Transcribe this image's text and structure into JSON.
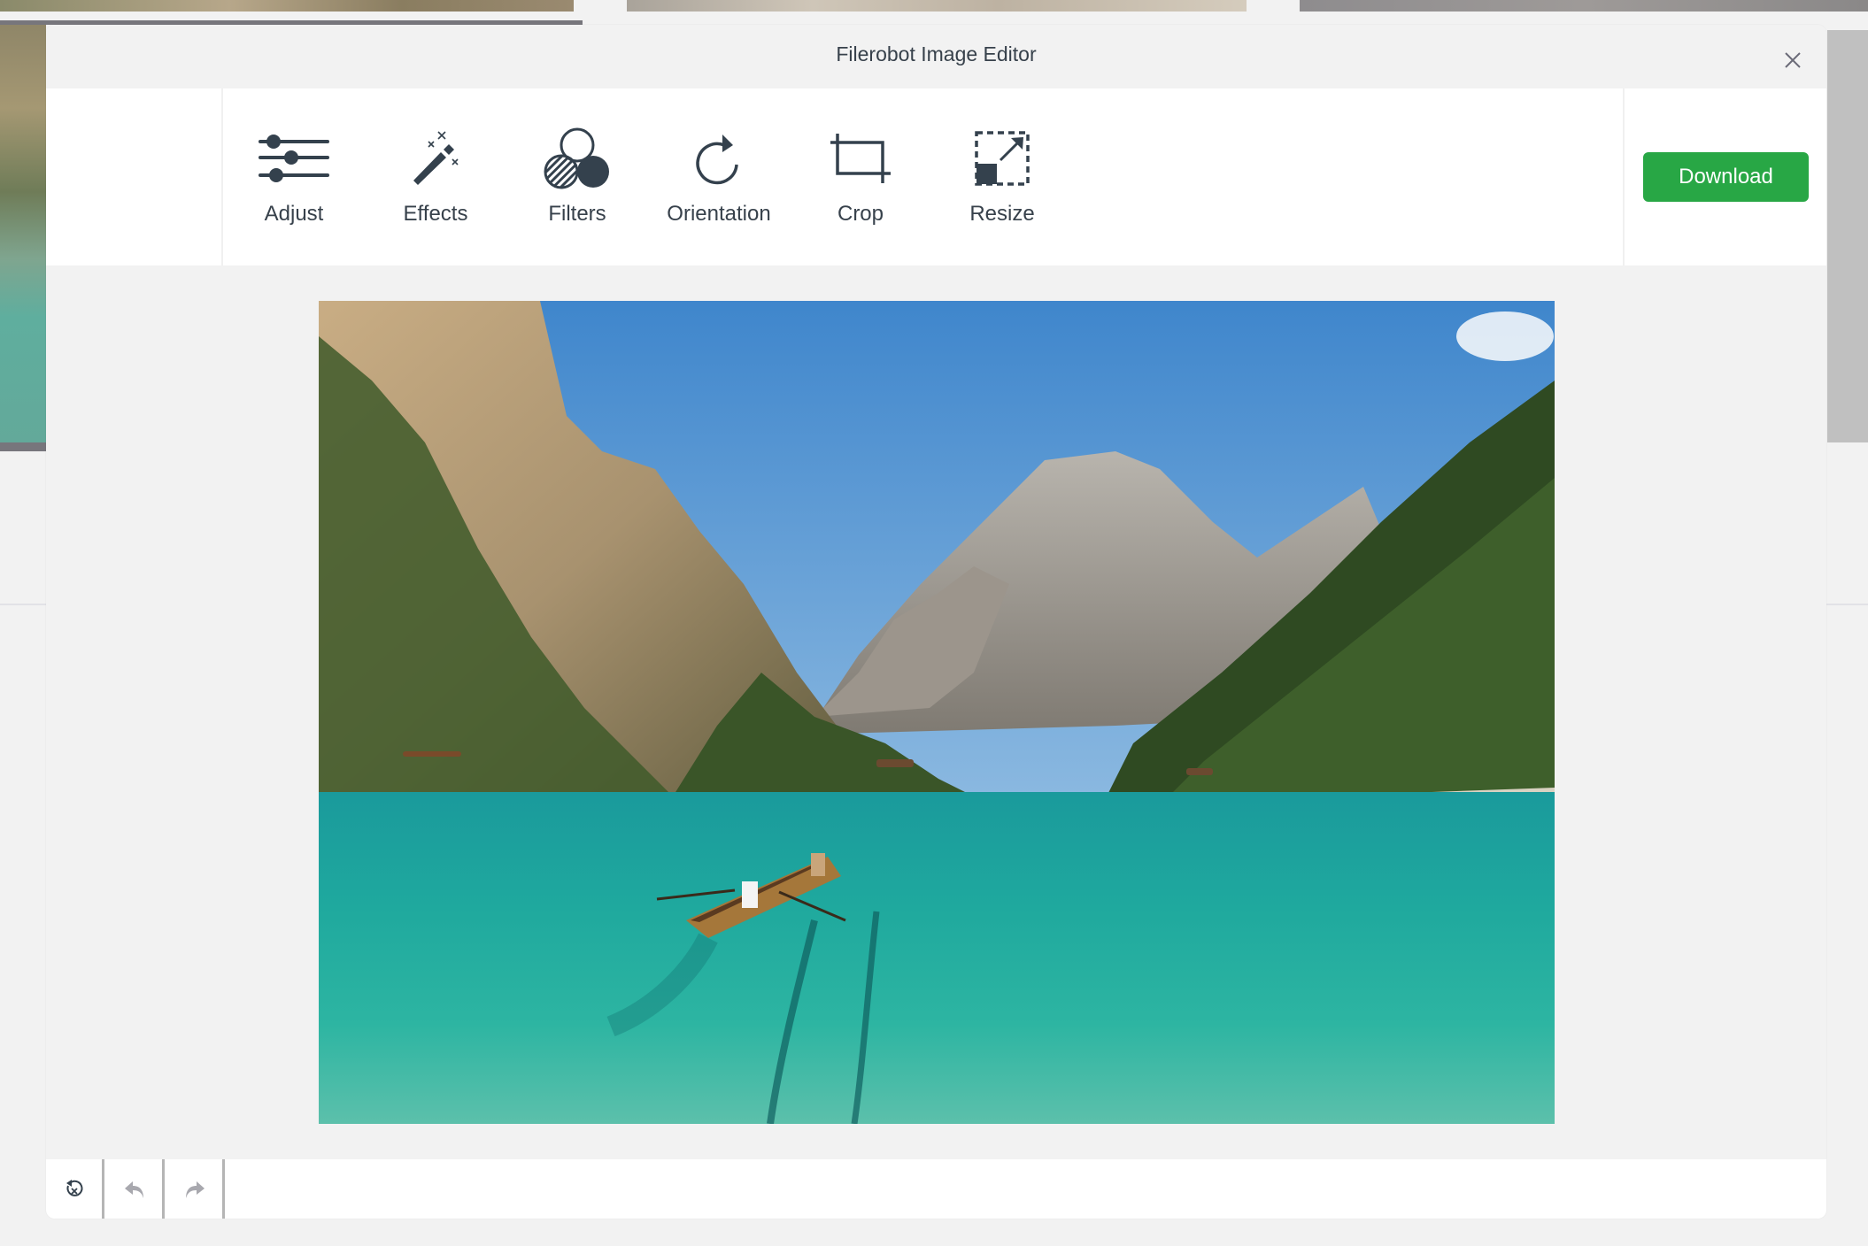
{
  "window": {
    "title": "Filerobot Image Editor"
  },
  "toolbar": {
    "tools": [
      {
        "id": "adjust",
        "label": "Adjust",
        "icon": "sliders-icon"
      },
      {
        "id": "effects",
        "label": "Effects",
        "icon": "magic-wand-icon"
      },
      {
        "id": "filters",
        "label": "Filters",
        "icon": "filters-circles-icon"
      },
      {
        "id": "orientation",
        "label": "Orientation",
        "icon": "rotate-icon"
      },
      {
        "id": "crop",
        "label": "Crop",
        "icon": "crop-icon"
      },
      {
        "id": "resize",
        "label": "Resize",
        "icon": "resize-icon"
      }
    ],
    "download_label": "Download"
  },
  "colors": {
    "accent": "#28a745",
    "icon": "#34414d",
    "text": "#37414b",
    "disabled_icon": "#a8a8ae",
    "panel": "#f2f2f2",
    "toolbar_bg": "#ffffff"
  },
  "canvas": {
    "image_description": "Mountain lake with turquoise water, rowing boats and forested cliffs"
  },
  "footer": {
    "buttons": [
      {
        "id": "reset",
        "icon": "reset-icon",
        "enabled": true
      },
      {
        "id": "undo",
        "icon": "undo-icon",
        "enabled": false
      },
      {
        "id": "redo",
        "icon": "redo-icon",
        "enabled": false
      }
    ]
  }
}
